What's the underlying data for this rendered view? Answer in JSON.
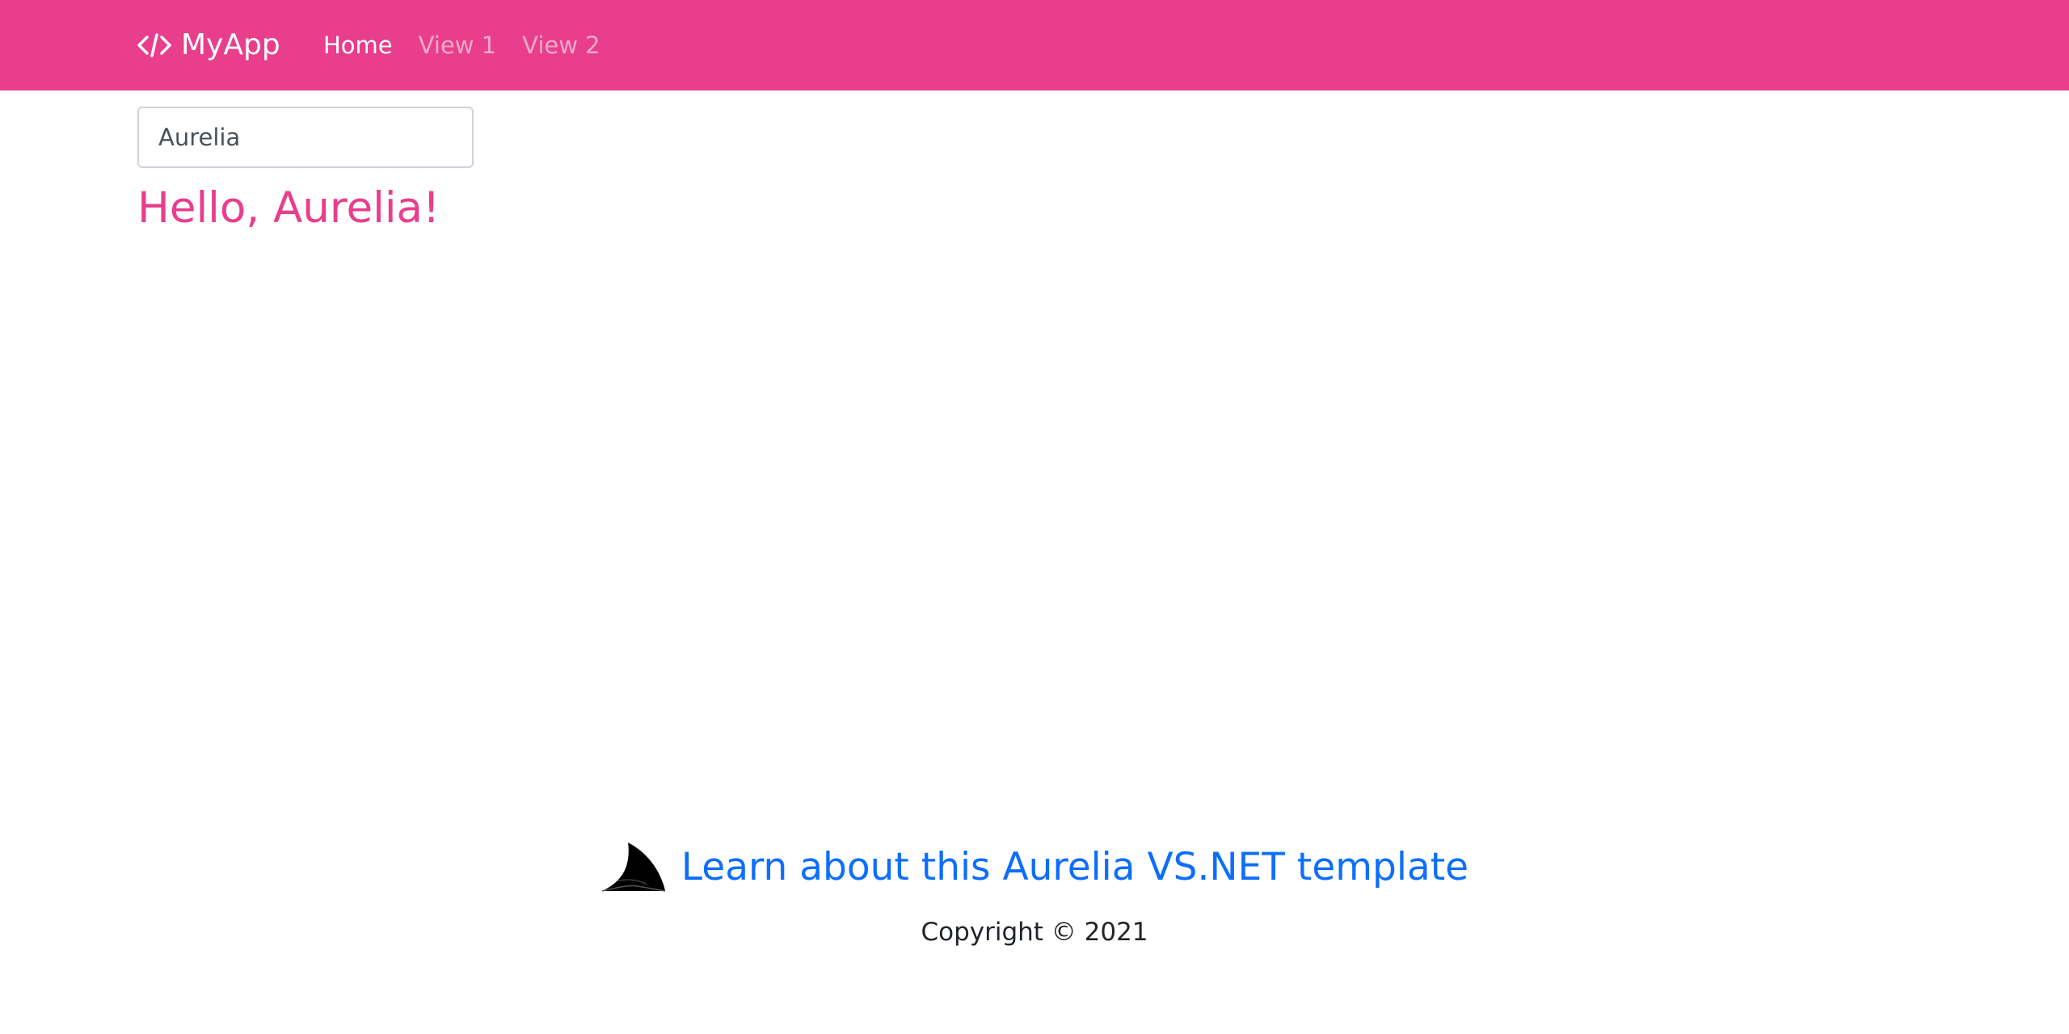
{
  "navbar": {
    "brand_icon": "code-icon",
    "brand_label": "MyApp",
    "links": [
      {
        "label": "Home",
        "active": true
      },
      {
        "label": "View 1",
        "active": false
      },
      {
        "label": "View 2",
        "active": false
      }
    ],
    "background": "#e83e8c"
  },
  "main": {
    "name_input": {
      "value": "Aurelia",
      "placeholder": ""
    },
    "greeting": "Hello, Aurelia!",
    "greeting_color": "#e83e8c"
  },
  "footer": {
    "logo_icon": "aurelia-fin-icon",
    "learn_link": "Learn about this Aurelia VS.NET template",
    "link_color": "#0d6efd",
    "copyright": "Copyright © 2021"
  }
}
